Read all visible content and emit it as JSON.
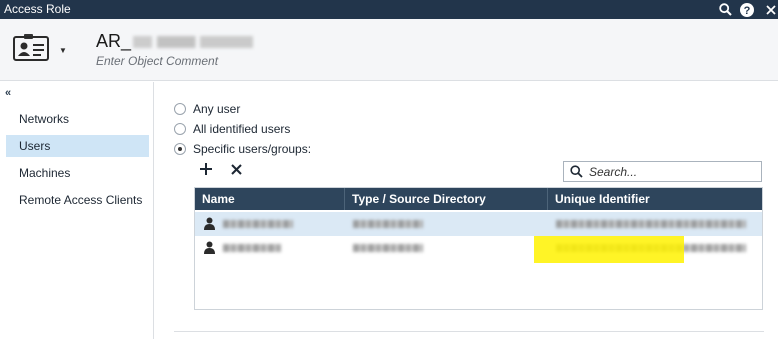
{
  "window": {
    "title": "Access Role"
  },
  "titlebar_icons": [
    "search-icon",
    "help-icon",
    "close-icon"
  ],
  "header": {
    "object_name_prefix": "AR_",
    "comment_placeholder": "Enter Object Comment"
  },
  "sidebar": {
    "collapse_glyph": "«",
    "items": [
      {
        "label": "Networks",
        "active": false
      },
      {
        "label": "Users",
        "active": true
      },
      {
        "label": "Machines",
        "active": false
      },
      {
        "label": "Remote Access Clients",
        "active": false
      }
    ]
  },
  "users": {
    "options": [
      {
        "label": "Any user",
        "checked": false
      },
      {
        "label": "All identified users",
        "checked": false
      },
      {
        "label": "Specific users/groups:",
        "checked": true
      }
    ],
    "toolbar": {
      "add_icon": "plus-icon",
      "remove_icon": "x-icon"
    },
    "search_placeholder": "Search...",
    "table": {
      "columns": [
        "Name",
        "Type / Source Directory",
        "Unique Identifier"
      ],
      "rows": [
        {
          "icon": "user-icon",
          "selected": true
        },
        {
          "icon": "user-icon",
          "selected": false
        }
      ]
    }
  },
  "colors": {
    "titlebar": "#22354b",
    "table_header": "#2e455c",
    "nav_active": "#cfe5f6",
    "row_selected": "#dbe9f5",
    "highlight": "#fff200"
  }
}
